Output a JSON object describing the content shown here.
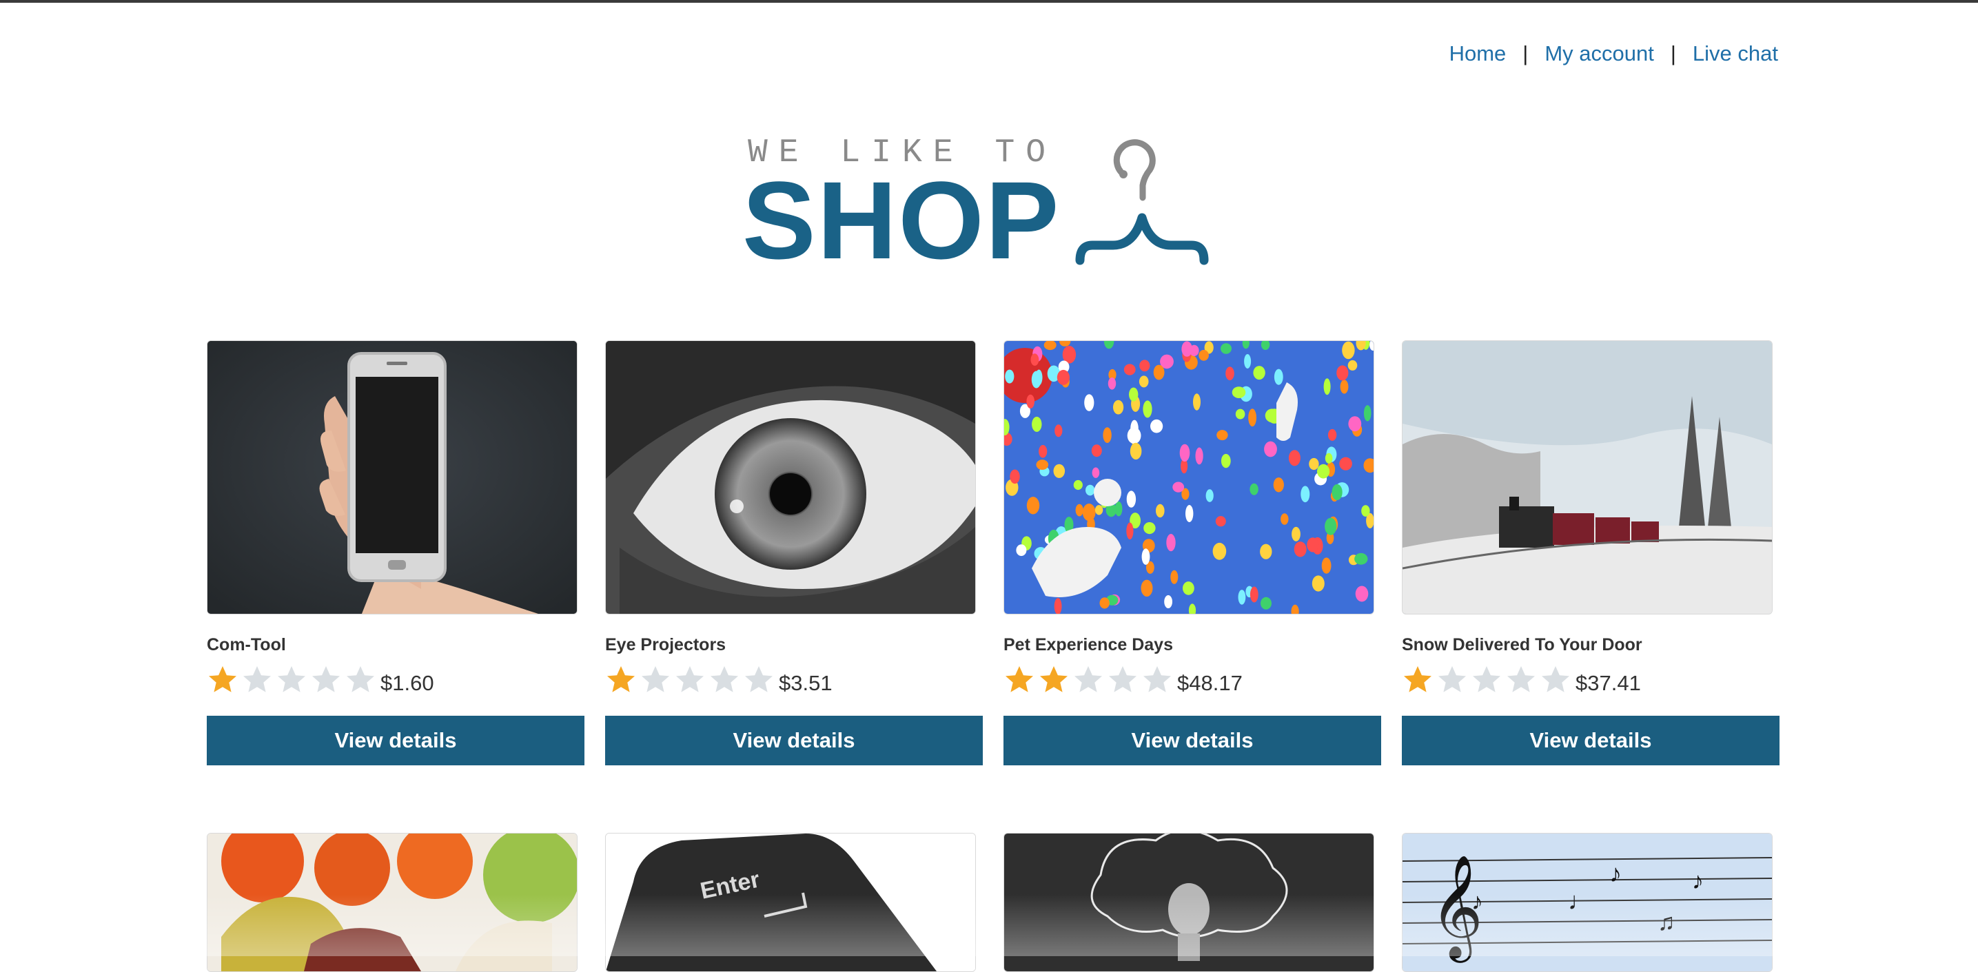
{
  "nav": {
    "home": "Home",
    "separator": "|",
    "account": "My account",
    "chat": "Live chat"
  },
  "logo": {
    "tagline": "WE LIKE TO",
    "wordmark": "SHOP",
    "icon": "hanger-icon"
  },
  "colors": {
    "brand": "#1a6287",
    "button": "#1b5e80",
    "link": "#1f6fa8",
    "star_filled": "#f5a623",
    "star_empty": "#d9dee2"
  },
  "products": [
    {
      "name": "Com-Tool",
      "rating": 1,
      "price": "$1.60",
      "button": "View details",
      "image": "phone-in-hand"
    },
    {
      "name": "Eye Projectors",
      "rating": 1,
      "price": "$3.51",
      "button": "View details",
      "image": "eye-closeup"
    },
    {
      "name": "Pet Experience Days",
      "rating": 2,
      "price": "$48.17",
      "button": "View details",
      "image": "dogs-with-balloons"
    },
    {
      "name": "Snow Delivered To Your Door",
      "rating": 1,
      "price": "$37.41",
      "button": "View details",
      "image": "steam-train-in-snow"
    }
  ],
  "products_row2": [
    {
      "image": "fruit"
    },
    {
      "image": "enter-key",
      "label": "Enter"
    },
    {
      "image": "lightbulb-chalkboard"
    },
    {
      "image": "music-staff-birds"
    }
  ]
}
